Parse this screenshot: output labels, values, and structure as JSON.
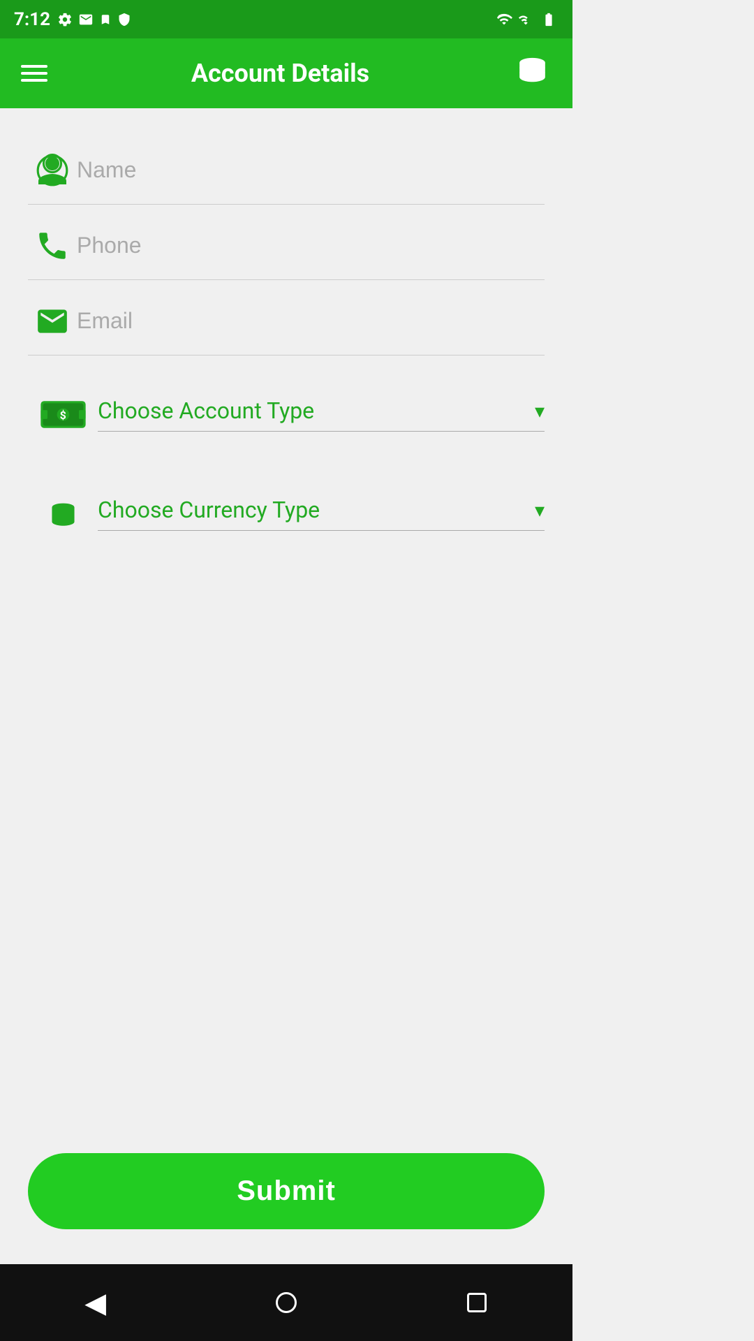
{
  "statusBar": {
    "time": "7:12",
    "icons": [
      "settings",
      "mail",
      "bookmark",
      "shield",
      "wifi",
      "signal",
      "battery"
    ]
  },
  "toolbar": {
    "title": "Account Details",
    "menuIcon": "menu-icon",
    "coinsIcon": "coins-icon"
  },
  "form": {
    "nameField": {
      "placeholder": "Name",
      "icon": "person-icon"
    },
    "phoneField": {
      "placeholder": "Phone",
      "icon": "phone-icon"
    },
    "emailField": {
      "placeholder": "Email",
      "icon": "email-icon"
    },
    "accountTypeDropdown": {
      "label": "Choose Account Type",
      "icon": "money-icon"
    },
    "currencyTypeDropdown": {
      "label": "Choose Currency Type",
      "icon": "coins-stack-icon"
    }
  },
  "submitButton": {
    "label": "Submit"
  },
  "navBar": {
    "backLabel": "◀",
    "homeLabel": "",
    "recentLabel": ""
  }
}
